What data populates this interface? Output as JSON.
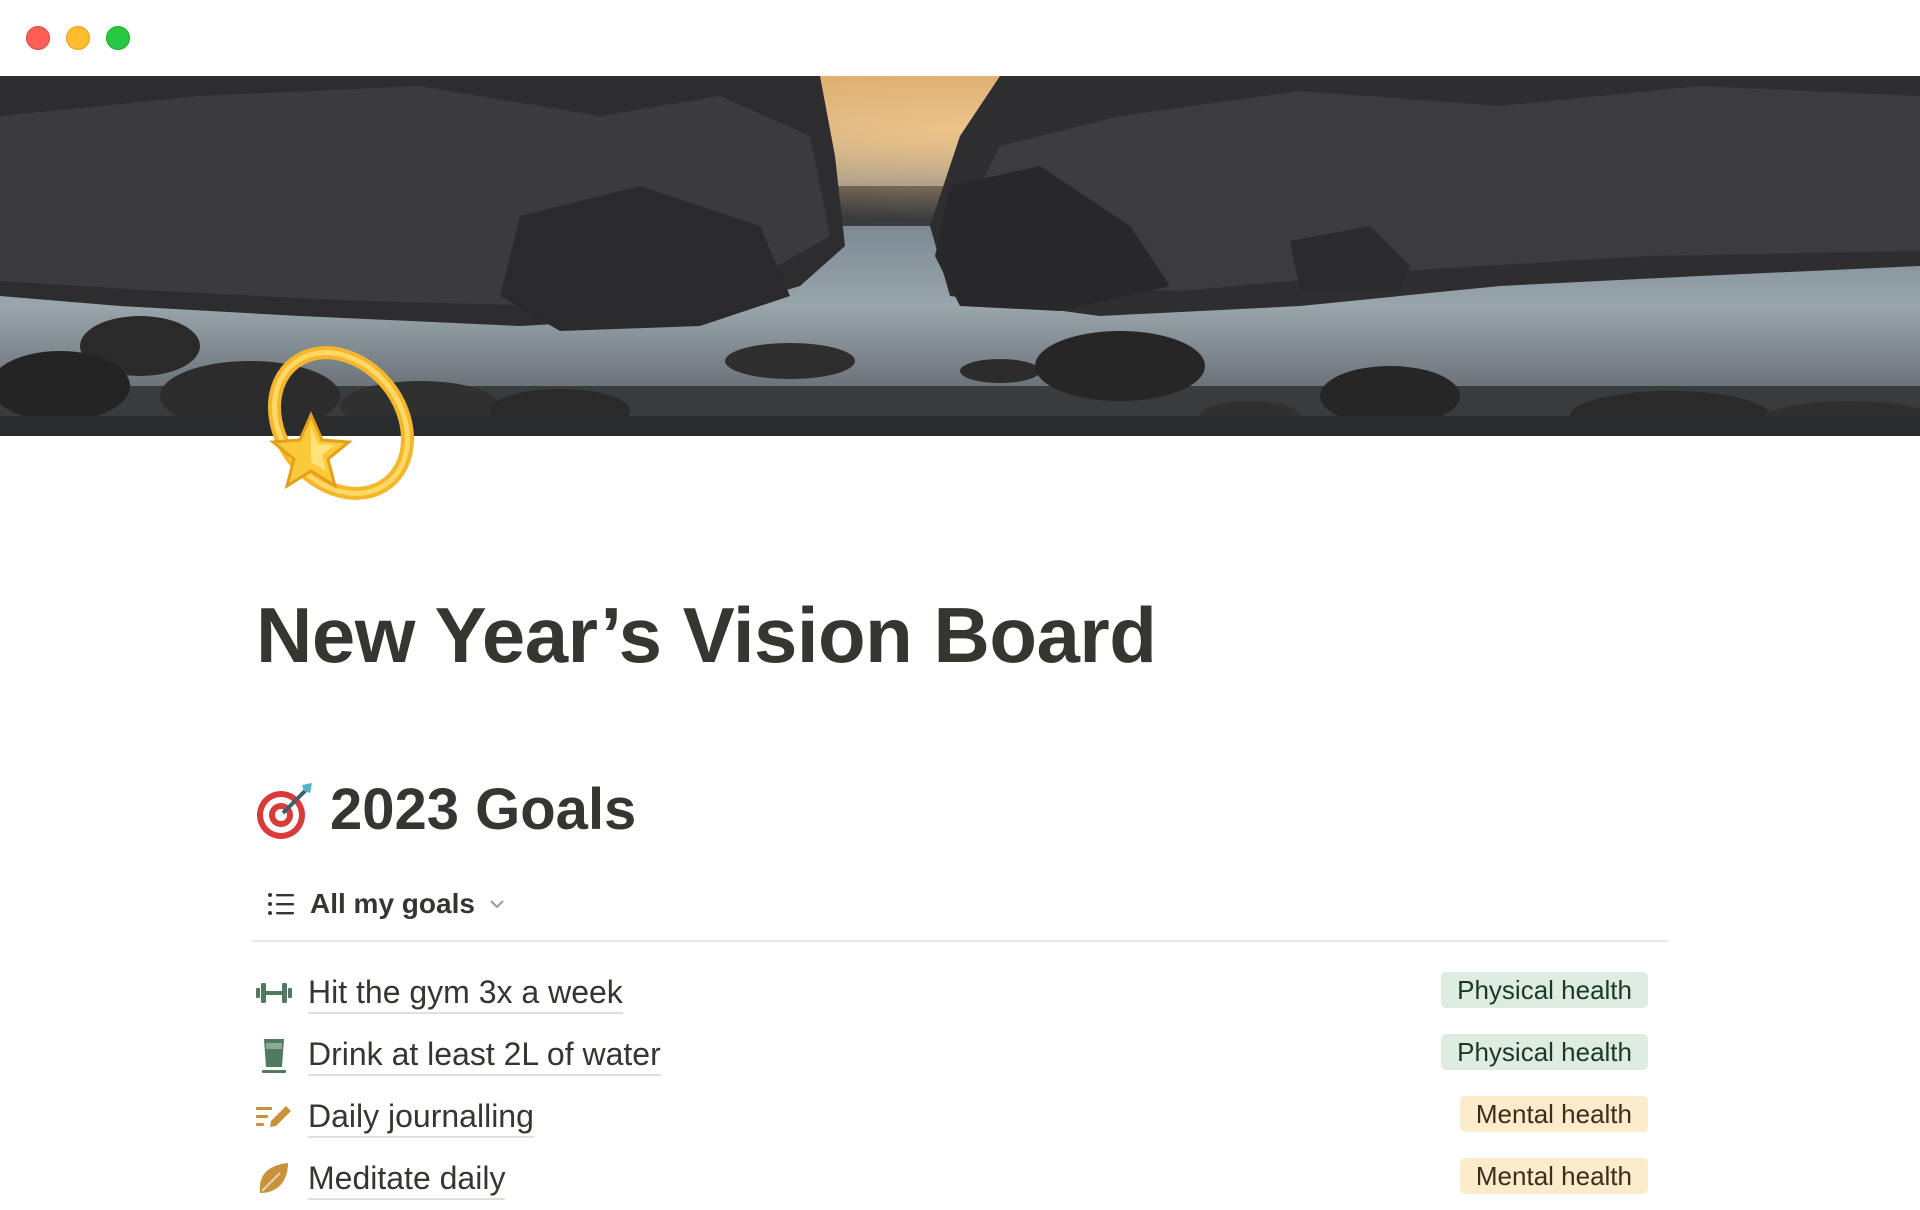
{
  "window": {
    "controls": [
      "close",
      "minimize",
      "maximize"
    ]
  },
  "cover": {
    "description_icon": "coastal-rocks-cover-image"
  },
  "page": {
    "icon": "dizzy-star-icon",
    "title": "New Year’s Vision Board"
  },
  "section": {
    "icon": "direct-hit-target-icon",
    "heading": "2023 Goals"
  },
  "view": {
    "icon": "list-icon",
    "label": "All my goals",
    "dropdown_icon": "chevron-down-icon"
  },
  "goals": [
    {
      "icon": "dumbbell-icon",
      "title": "Hit the gym 3x a week",
      "tag": "Physical health",
      "tag_bg": "#dfece2",
      "tag_color": "#1c3829",
      "icon_color": "#4f7a5e"
    },
    {
      "icon": "glass-icon",
      "title": "Drink at least 2L of water",
      "tag": "Physical health",
      "tag_bg": "#dfece2",
      "tag_color": "#1c3829",
      "icon_color": "#4f7a5e"
    },
    {
      "icon": "pencil-lines-icon",
      "title": "Daily journalling",
      "tag": "Mental health",
      "tag_bg": "#fbeccc",
      "tag_color": "#402c1b",
      "icon_color": "#c8923b"
    },
    {
      "icon": "leaf-icon",
      "title": "Meditate daily",
      "tag": "Mental health",
      "tag_bg": "#fbeccc",
      "tag_color": "#402c1b",
      "icon_color": "#c8923b"
    }
  ]
}
